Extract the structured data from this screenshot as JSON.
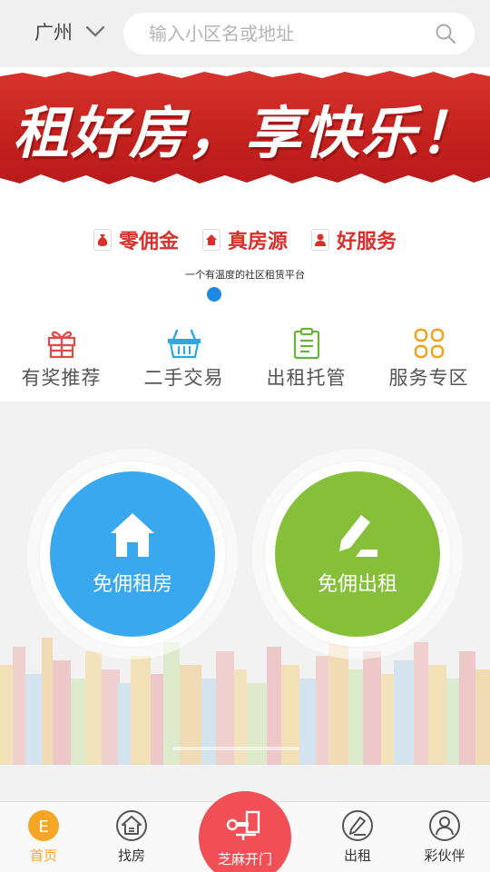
{
  "header": {
    "city": "广州",
    "search_placeholder": "输入小区名或地址"
  },
  "banner": {
    "headline": "租好房，享快乐！",
    "features": [
      {
        "label": "零佣金",
        "icon": "money-bag-icon"
      },
      {
        "label": "真房源",
        "icon": "house-icon"
      },
      {
        "label": "好服务",
        "icon": "person-icon"
      }
    ],
    "subtitle": "一个有温度的社区租赁平台",
    "colors": {
      "ribbon": "#c5221f",
      "feature_text": "#d9302a",
      "dot": "#1e88e5"
    }
  },
  "shortcuts": [
    {
      "label": "有奖推荐",
      "icon": "gift-icon",
      "color": "#e24a4a"
    },
    {
      "label": "二手交易",
      "icon": "basket-icon",
      "color": "#29a9e0"
    },
    {
      "label": "出租托管",
      "icon": "clipboard-icon",
      "color": "#69b33b"
    },
    {
      "label": "服务专区",
      "icon": "grid-icon",
      "color": "#f0a31a"
    }
  ],
  "main": {
    "rent": {
      "label": "免佣租房",
      "icon": "house-icon",
      "color": "#3aa8ef"
    },
    "lease": {
      "label": "免佣出租",
      "icon": "edit-icon",
      "color": "#86c03a"
    }
  },
  "bottom_nav": {
    "home": {
      "label": "首页",
      "icon_letter": "E",
      "color": "#f5a623"
    },
    "find": {
      "label": "找房"
    },
    "center": {
      "label": "芝麻开门",
      "color": "#ef4f55"
    },
    "lease": {
      "label": "出租"
    },
    "partner": {
      "label": "彩伙伴"
    }
  }
}
